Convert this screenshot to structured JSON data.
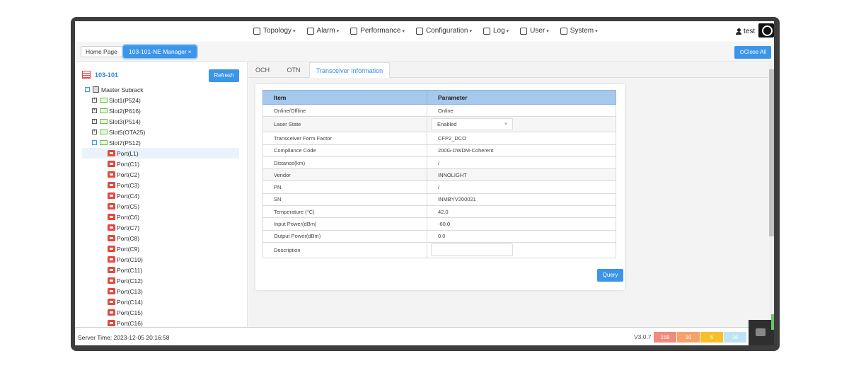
{
  "menu": {
    "items": [
      {
        "label": "Topology",
        "icon": "topology-icon"
      },
      {
        "label": "Alarm",
        "icon": "alarm-icon"
      },
      {
        "label": "Performance",
        "icon": "performance-icon"
      },
      {
        "label": "Configuration",
        "icon": "configuration-icon"
      },
      {
        "label": "Log",
        "icon": "log-icon"
      },
      {
        "label": "User",
        "icon": "user-group-icon"
      },
      {
        "label": "System",
        "icon": "system-icon"
      }
    ],
    "user": "test"
  },
  "tabs": {
    "home": "Home Page",
    "active": "103-101-NE Manager",
    "close_glyph": "×",
    "close_all": "⊙Close All"
  },
  "tree": {
    "root": "103-101",
    "refresh": "Refresh",
    "subrack": "Master Subrack",
    "slots": [
      "Slot1(P524)",
      "Slot2(P616)",
      "Slot3(P514)",
      "Slot5(OTA25)",
      "Slot7(P512)"
    ],
    "ports": [
      "Port(L1)",
      "Port(C1)",
      "Port(C2)",
      "Port(C3)",
      "Port(C4)",
      "Port(C5)",
      "Port(C6)",
      "Port(C7)",
      "Port(C8)",
      "Port(C9)",
      "Port(C10)",
      "Port(C11)",
      "Port(C12)",
      "Port(C13)",
      "Port(C14)",
      "Port(C15)",
      "Port(C16)"
    ]
  },
  "subtabs": [
    "OCH",
    "OTN",
    "Transceiver Information"
  ],
  "table": {
    "headers": [
      "Item",
      "Parameter"
    ],
    "rows": [
      {
        "item": "Online/Offline",
        "value": "Online"
      },
      {
        "item": "Laser State",
        "value": "Enabled"
      },
      {
        "item": "Transceiver Form Factor",
        "value": "CFP2_DCO"
      },
      {
        "item": "Compliance Code",
        "value": "200G-DWDM-Coherent"
      },
      {
        "item": "Distance(km)",
        "value": "/"
      },
      {
        "item": "Vendor",
        "value": "INNOLIGHT"
      },
      {
        "item": "PN",
        "value": "/"
      },
      {
        "item": "SN",
        "value": "INMBYV200021"
      },
      {
        "item": "Temperature (°C)",
        "value": "42.0"
      },
      {
        "item": "Input Power(dBm)",
        "value": "-60.0"
      },
      {
        "item": "Output Power(dBm)",
        "value": "0.0"
      },
      {
        "item": "Description",
        "value": ""
      }
    ],
    "query": "Query"
  },
  "footer": {
    "server_time": "Server Time:  2023-12-05 20:16:58",
    "version": "V3.0.7",
    "alarm_counts": [
      {
        "value": "158",
        "color": "#f08a7e"
      },
      {
        "value": "10",
        "color": "#f5a36b"
      },
      {
        "value": "5",
        "color": "#f7c02a"
      },
      {
        "value": "36",
        "color": "#bfe3f3"
      }
    ]
  }
}
